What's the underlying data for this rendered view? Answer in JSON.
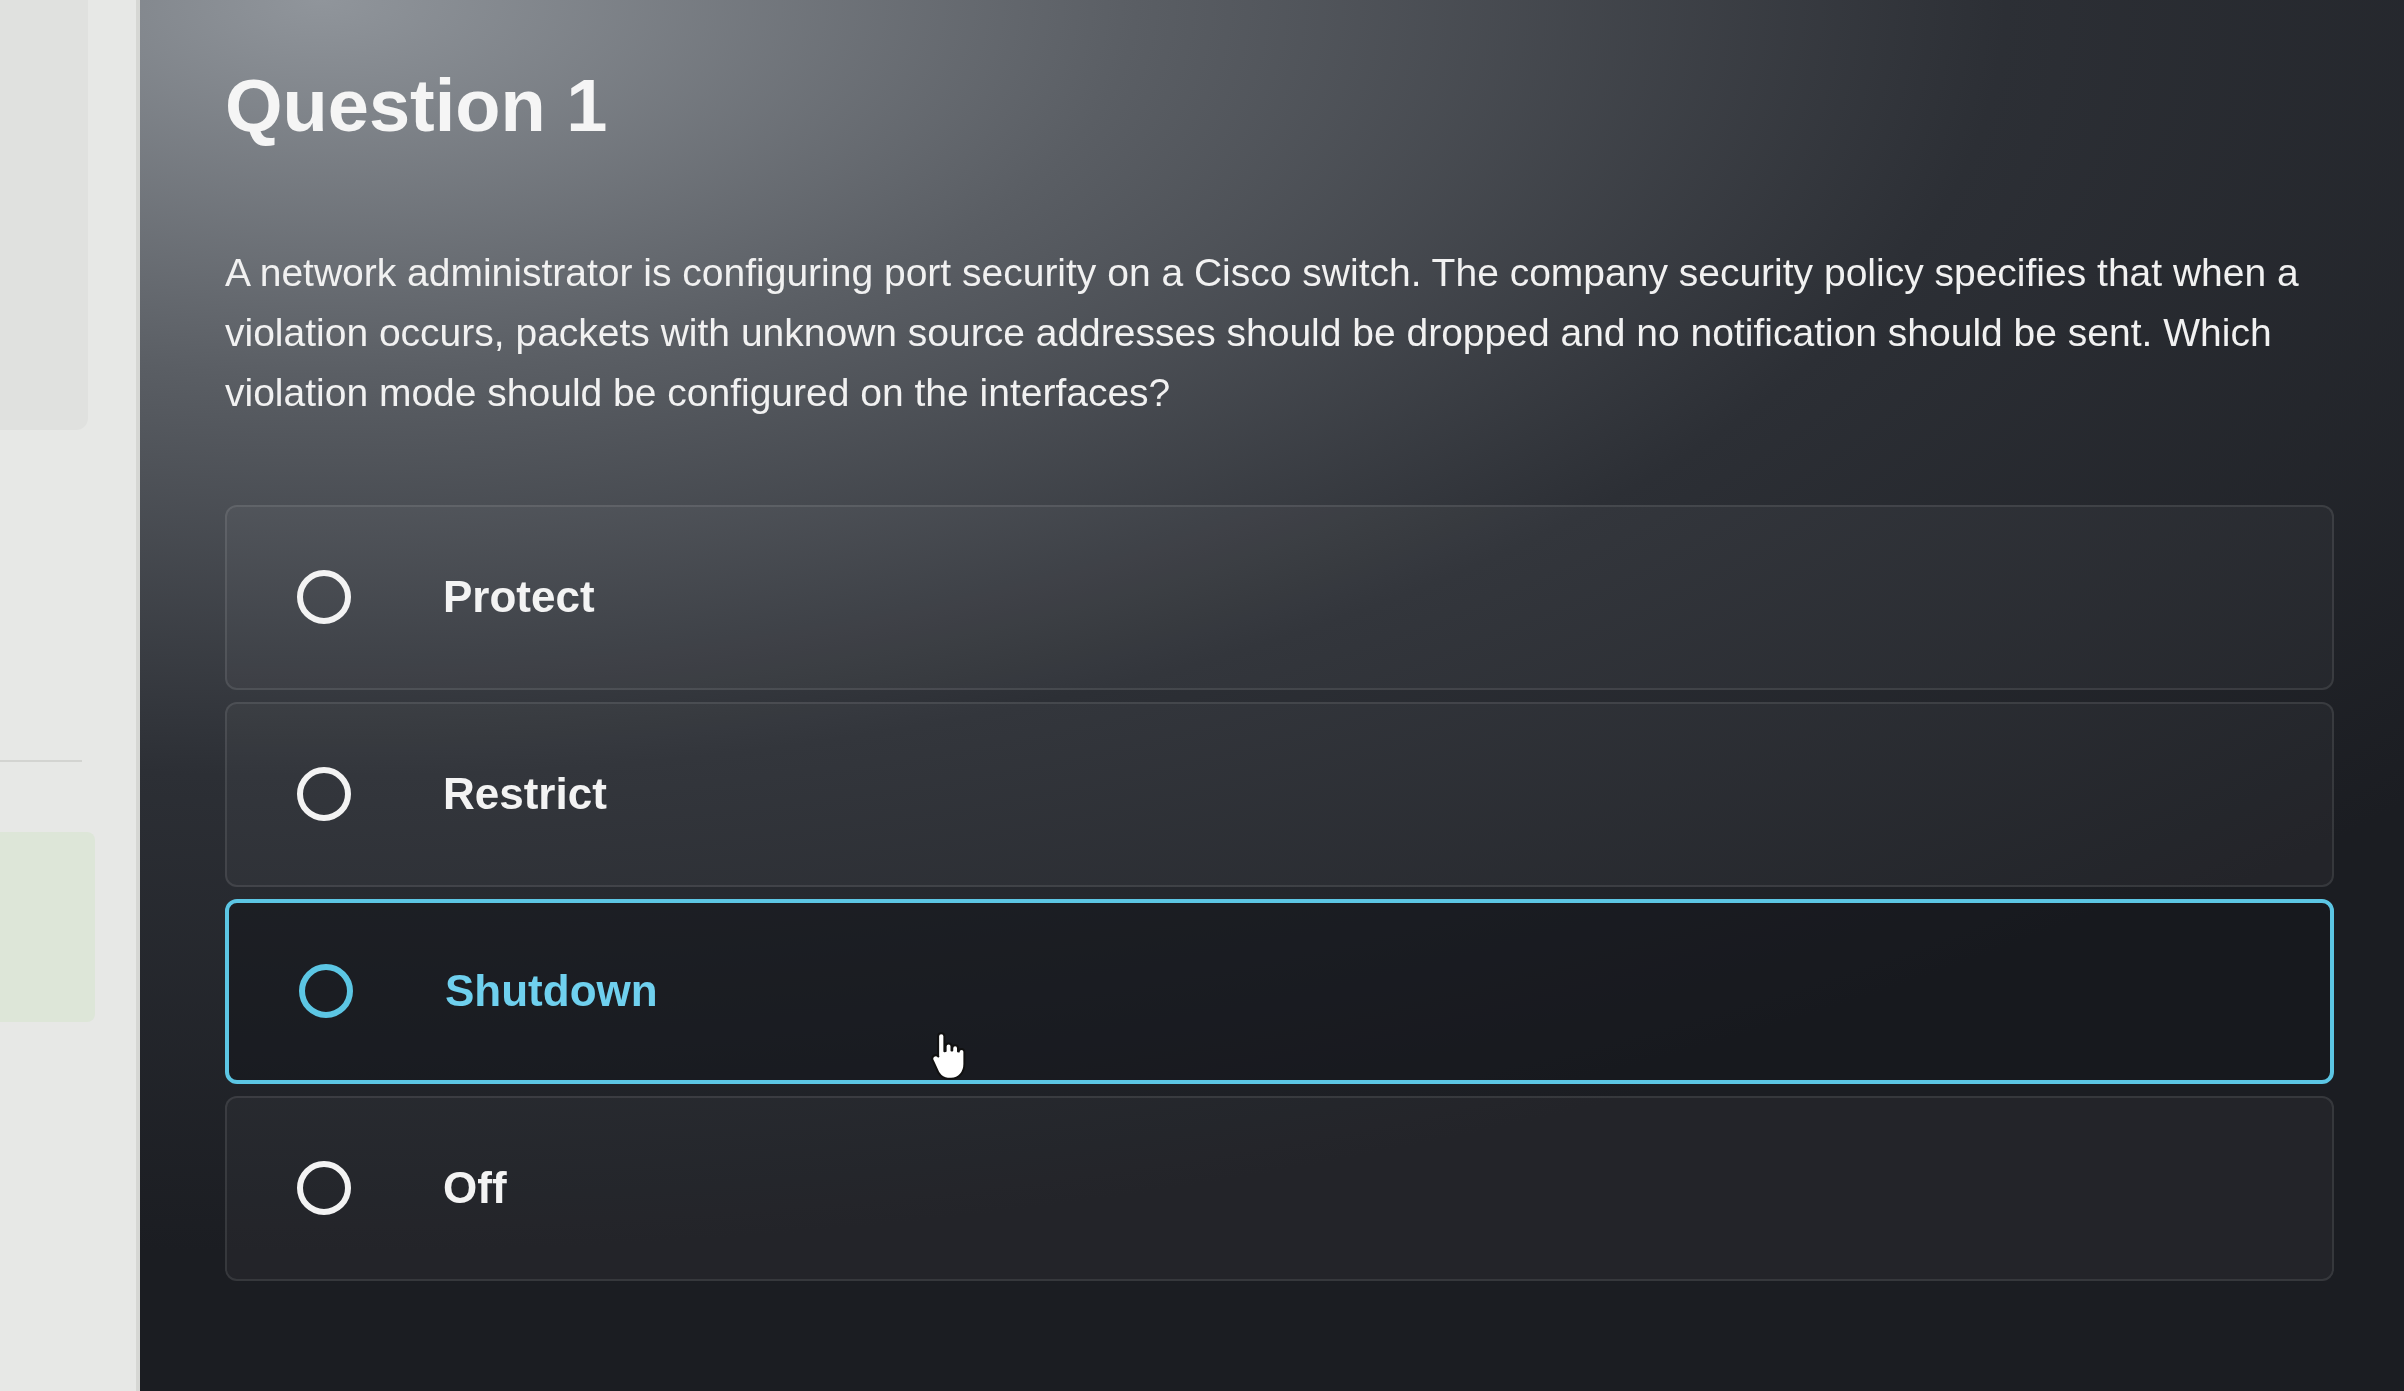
{
  "question": {
    "title": "Question 1",
    "text": "A network administrator is configuring port security on a Cisco switch. The company security policy specifies that when a violation occurs, packets with unknown source addresses should be dropped and no notification should be sent. Which violation mode should be configured on the interfaces?"
  },
  "options": [
    {
      "label": "Protect",
      "selected": false,
      "highlighted": false
    },
    {
      "label": "Restrict",
      "selected": false,
      "highlighted": false
    },
    {
      "label": "Shutdown",
      "selected": false,
      "highlighted": true
    },
    {
      "label": "Off",
      "selected": false,
      "highlighted": false
    }
  ]
}
